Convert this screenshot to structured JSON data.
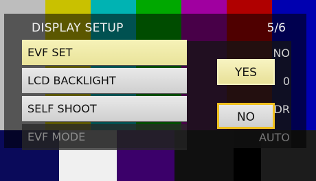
{
  "header": {
    "title": "DISPLAY SETUP",
    "page": "5/6"
  },
  "menu": {
    "items": [
      {
        "label": "EVF SET",
        "value": "NO",
        "state": "selected"
      },
      {
        "label": "LCD BACKLIGHT",
        "value": "0",
        "state": "normal"
      },
      {
        "label": "SELF SHOOT",
        "value": "DR",
        "state": "normal"
      },
      {
        "label": "EVF MODE",
        "value": "AUTO",
        "state": "disabled"
      }
    ]
  },
  "popup": {
    "yes_label": "YES",
    "no_label": "NO",
    "focused": "NO"
  },
  "colors": {
    "bars_top": [
      "#bdbdbd",
      "#c9c100",
      "#00b3b3",
      "#00a800",
      "#a000a0",
      "#b00000",
      "#0000b0"
    ],
    "bars_bottom": [
      "#0a0a5a",
      "#f0f0f0",
      "#3b006a",
      "#101010",
      "#000000",
      "#1c1c1c"
    ],
    "selected_row": "#f0eaa8",
    "focus_border": "#f0c020"
  }
}
